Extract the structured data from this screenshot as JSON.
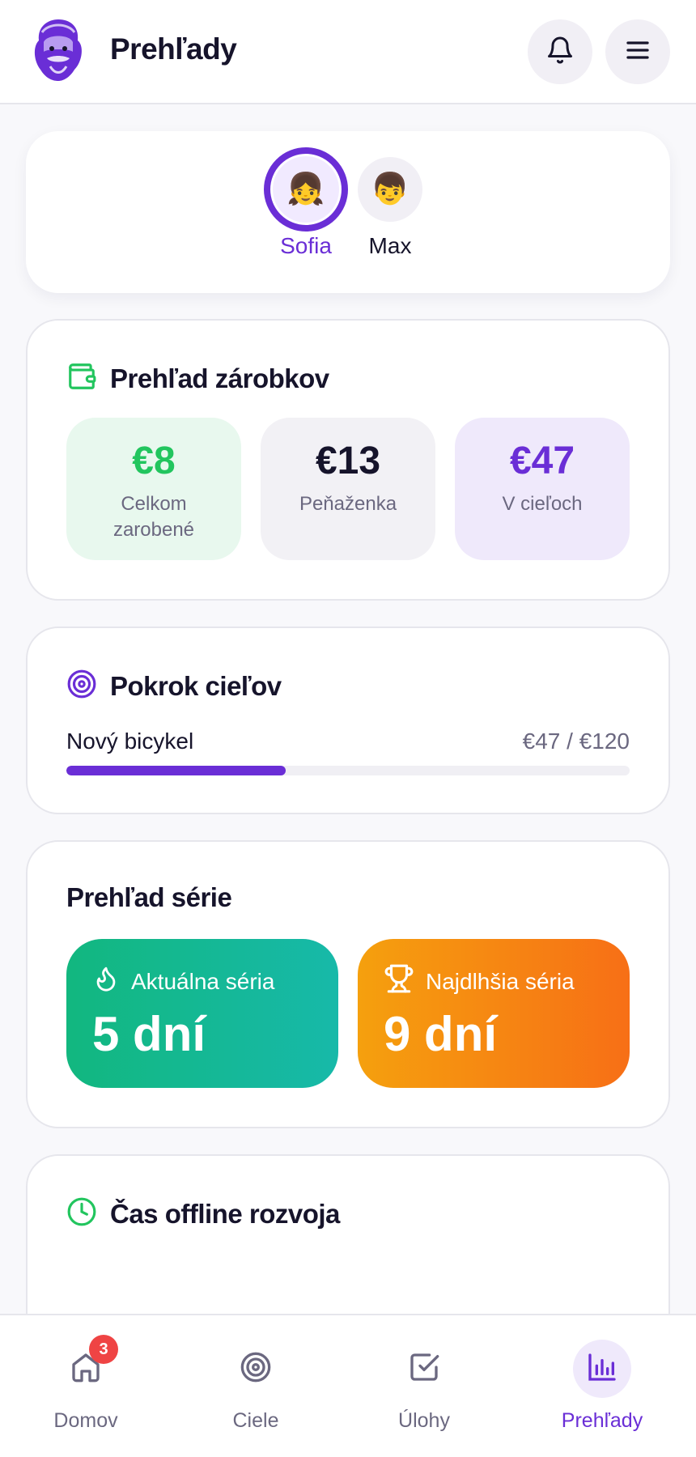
{
  "header": {
    "title": "Prehľady",
    "logo_icon": "bearded-man-logo",
    "notifications_icon": "bell-icon",
    "menu_icon": "hamburger-menu-icon"
  },
  "profiles": [
    {
      "name": "Sofia",
      "emoji": "👧",
      "active": true
    },
    {
      "name": "Max",
      "emoji": "👦",
      "active": false
    }
  ],
  "earnings": {
    "title": "Prehľad zárobkov",
    "icon": "wallet-icon",
    "stats": [
      {
        "value": "€8",
        "label": "Celkom zarobené",
        "color": "#22c55e",
        "bg": "#e8f8ee"
      },
      {
        "value": "€13",
        "label": "Peňaženka",
        "color": "#16142b",
        "bg": "#f2f1f5"
      },
      {
        "value": "€47",
        "label": "V cieľoch",
        "color": "#6a2ed6",
        "bg": "#efe9fb"
      }
    ]
  },
  "goals": {
    "title": "Pokrok cieľov",
    "icon": "target-icon",
    "items": [
      {
        "name": "Nový bicykel",
        "amount": "€47 / €120",
        "progress": 0.39
      }
    ]
  },
  "streaks": {
    "title": "Prehľad série",
    "current": {
      "label": "Aktuálna séria",
      "value": "5 dní",
      "icon": "flame-icon"
    },
    "longest": {
      "label": "Najdlhšia séria",
      "value": "9 dní",
      "icon": "trophy-icon"
    }
  },
  "offline": {
    "title": "Čas offline rozvoja",
    "icon": "clock-icon"
  },
  "nav": {
    "items": [
      {
        "label": "Domov",
        "icon": "home-icon",
        "badge": "3",
        "active": false
      },
      {
        "label": "Ciele",
        "icon": "target-icon",
        "active": false
      },
      {
        "label": "Úlohy",
        "icon": "checkbox-icon",
        "active": false
      },
      {
        "label": "Prehľady",
        "icon": "bar-chart-icon",
        "active": true
      }
    ]
  },
  "colors": {
    "primary": "#6a2ed6",
    "success": "#22c55e",
    "badge": "#ef4444",
    "text": "#16142b",
    "muted": "#6b6880"
  }
}
